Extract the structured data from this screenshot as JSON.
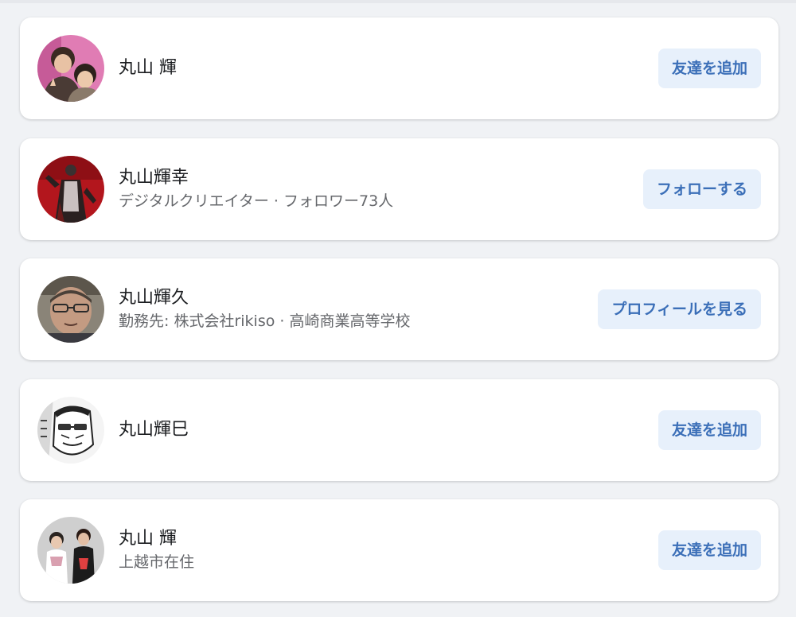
{
  "results": [
    {
      "name": "丸山 輝",
      "subtitle": "",
      "action": "友達を追加",
      "avatar_icon": "profile-photo-two-boys"
    },
    {
      "name": "丸山輝幸",
      "subtitle": "デジタルクリエイター · フォロワー73人",
      "action": "フォローする",
      "avatar_icon": "profile-photo-costume"
    },
    {
      "name": "丸山輝久",
      "subtitle": "勤務先: 株式会社rikiso · 高崎商業高等学校",
      "action": "プロフィールを見る",
      "avatar_icon": "profile-photo-man-glasses"
    },
    {
      "name": "丸山輝巳",
      "subtitle": "",
      "action": "友達を追加",
      "avatar_icon": "profile-photo-manga-face"
    },
    {
      "name": "丸山 輝",
      "subtitle": "上越市在住",
      "action": "友達を追加",
      "avatar_icon": "profile-photo-two-people"
    }
  ],
  "colors": {
    "background": "#f0f2f5",
    "card": "#ffffff",
    "button_bg": "#e7f0fb",
    "button_text": "#3b6fb8",
    "name_text": "#1c1e21",
    "sub_text": "#65676b"
  }
}
